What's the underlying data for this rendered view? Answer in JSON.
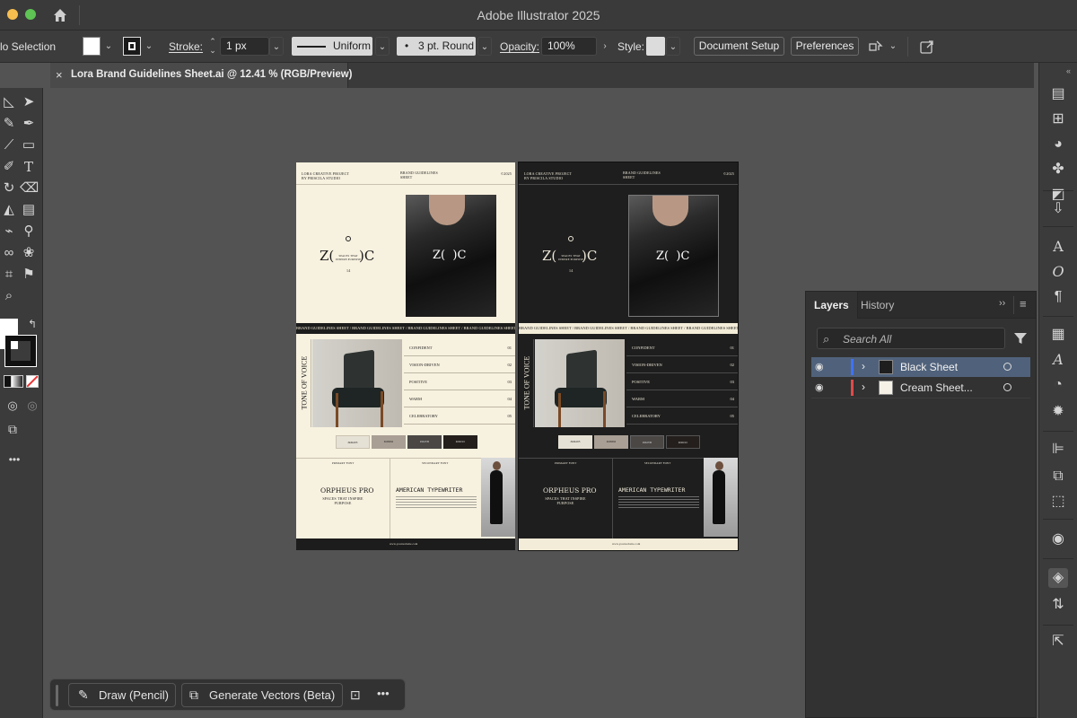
{
  "app": {
    "title": "Adobe Illustrator 2025"
  },
  "controlbar": {
    "selection_label": "No Selection",
    "selection_label_visible": "lo Selection",
    "stroke_label": "Stroke:",
    "stroke_weight": "1 px",
    "stroke_profile": "Uniform",
    "brush": "3 pt. Round",
    "opacity_label": "Opacity:",
    "opacity_value": "100%",
    "style_label": "Style:",
    "document_setup": "Document Setup",
    "preferences": "Preferences"
  },
  "document_tab": {
    "title": "Lora Brand Guidelines Sheet.ai @ 12.41 % (RGB/Preview)",
    "close": "×"
  },
  "layers_panel": {
    "tabs": [
      "Layers",
      "History"
    ],
    "active_tab": "Layers",
    "search_placeholder": "Search All",
    "layers": [
      {
        "name": "Black Sheet",
        "color": "#3d72ff",
        "selected": true
      },
      {
        "name": "Cream Sheet...",
        "color": "#e24a4a",
        "selected": false
      }
    ]
  },
  "context_bar": {
    "draw_label": "Draw (Pencil)",
    "generate_label": "Generate Vectors (Beta)",
    "more": "•••"
  },
  "artwork": {
    "header_left": "LORA CREATIVE PROJECT\nBY PRISCILA STUDIO",
    "header_mid": "BRAND GUIDELINES\nSHEET",
    "header_right": "©2025",
    "logo_left": "Z(",
    "logo_right ": ")C",
    "logo_mid": "SPACES THAT\nINSPIRE PURPOSE",
    "logo_number": "14",
    "strip_text": "BRAND GUIDELINES SHEET / BRAND GUIDELINES SHEET / BRAND GUIDELINES SHEET / BRAND GUIDELINES SHEET",
    "tone_label": "TONE OF VOICE",
    "tone_items": [
      {
        "label": "CONFIDENT",
        "num": "01"
      },
      {
        "label": "VISION-DRIVEN",
        "num": "02"
      },
      {
        "label": "POSITIVE",
        "num": "03"
      },
      {
        "label": "WARM",
        "num": "04"
      },
      {
        "label": "CELEBRATORY",
        "num": "05"
      }
    ],
    "swatches": [
      {
        "color": "#e6e1d5",
        "label": "#E6E1D5"
      },
      {
        "color": "#a99f94",
        "label": "#A99F94"
      },
      {
        "color": "#4a4745",
        "label": "#4A4745"
      },
      {
        "color": "#241f1c",
        "label": "#241F1C"
      }
    ],
    "primary_font_label": "PRIMARY FONT",
    "primary_font": "ORPHEUS PRO",
    "primary_sub": "SPACES THAT INSPIRE\nPURPOSE",
    "secondary_font_label": "SECONDARY FONT",
    "secondary_font": "AMERICAN TYPEWRITER",
    "footer_url": "www.yourwebsite.com"
  }
}
